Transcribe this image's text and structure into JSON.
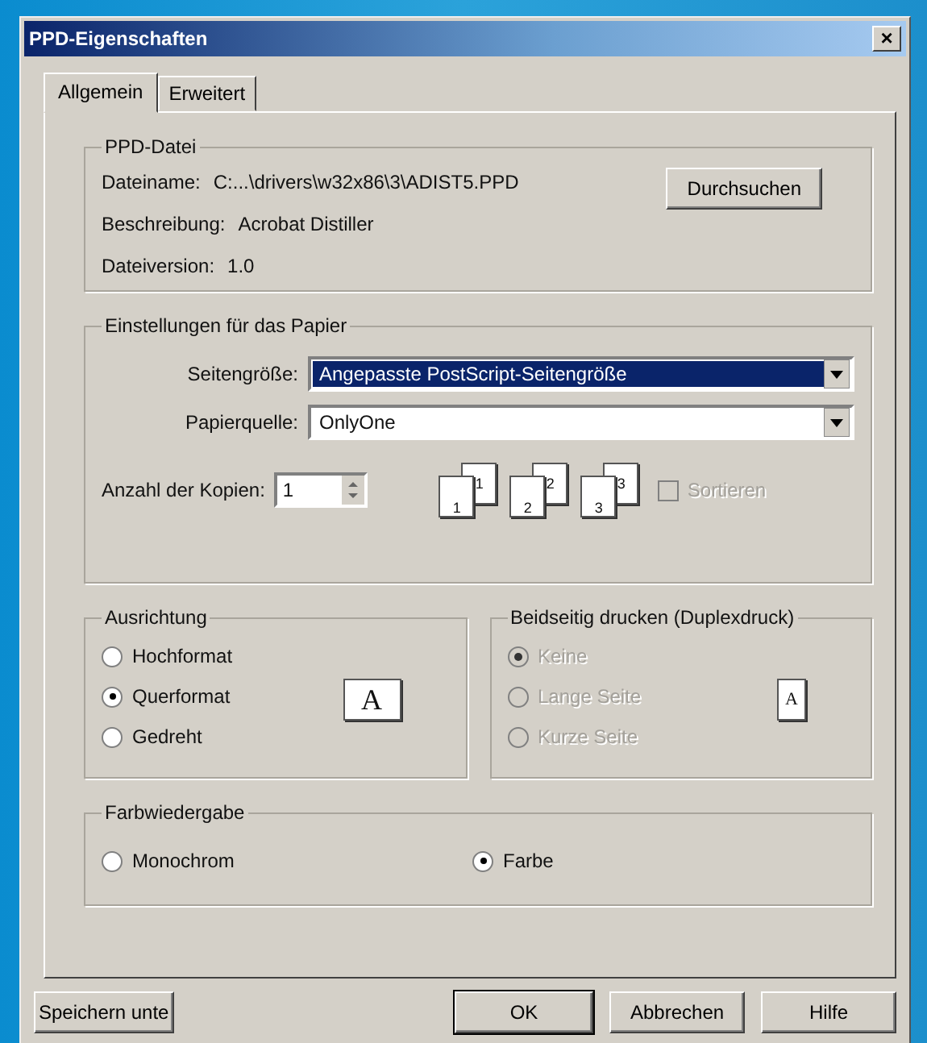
{
  "window": {
    "title": "PPD-Eigenschaften",
    "close": "×"
  },
  "tabs": [
    {
      "label": "Allgemein",
      "selected": true
    },
    {
      "label": "Erweitert",
      "selected": false
    }
  ],
  "ppd_file": {
    "title": "PPD-Datei",
    "rows": [
      {
        "label": "Dateiname:",
        "value": "C:...\\drivers\\w32x86\\3\\ADIST5.PPD"
      },
      {
        "label": "Beschreibung:",
        "value": "Acrobat Distiller"
      },
      {
        "label": "Dateiversion:",
        "value": "1.0"
      }
    ],
    "browse_button": "Durchsuchen"
  },
  "paper": {
    "title": "Einstellungen für das Papier",
    "page_size": {
      "label": "Seitengröße:",
      "value": "Angepasste PostScript-Seitengröße",
      "selected": true
    },
    "paper_source": {
      "label": "Papierquelle:",
      "value": "OnlyOne",
      "selected": false
    },
    "copies": {
      "label": "Anzahl der Kopien:",
      "value": "1"
    },
    "collate_stacks": [
      {
        "back": "1",
        "front": "1"
      },
      {
        "back": "2",
        "front": "2"
      },
      {
        "back": "3",
        "front": "3"
      }
    ],
    "collate": {
      "label": "Sortieren",
      "checked": false,
      "disabled": true
    }
  },
  "orientation": {
    "title": "Ausrichtung",
    "options": [
      {
        "label": "Hochformat",
        "selected": false,
        "disabled": false
      },
      {
        "label": "Querformat",
        "selected": true,
        "disabled": false
      },
      {
        "label": "Gedreht",
        "selected": false,
        "disabled": false
      }
    ],
    "preview": "A"
  },
  "duplex": {
    "title": "Beidseitig drucken (Duplexdruck)",
    "options": [
      {
        "label": "Keine",
        "selected": true,
        "disabled": true
      },
      {
        "label": "Lange Seite",
        "selected": false,
        "disabled": true
      },
      {
        "label": "Kurze Seite",
        "selected": false,
        "disabled": true
      }
    ],
    "preview": "A"
  },
  "color": {
    "title": "Farbwiedergabe",
    "options": [
      {
        "label": "Monochrom",
        "selected": false,
        "disabled": false
      },
      {
        "label": "Farbe",
        "selected": true,
        "disabled": false
      }
    ]
  },
  "buttons": [
    {
      "label": "Speichern unte",
      "kind": "left"
    },
    {
      "label": "OK",
      "kind": "default"
    },
    {
      "label": "Abbrechen",
      "kind": "normal"
    },
    {
      "label": "Hilfe",
      "kind": "normal"
    }
  ]
}
